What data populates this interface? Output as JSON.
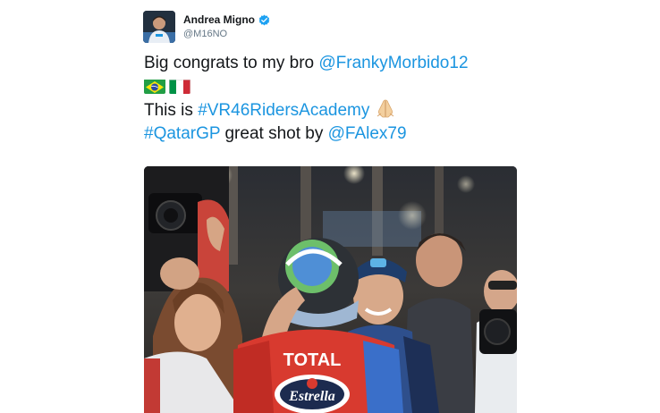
{
  "tweet": {
    "author": {
      "display_name": "Andrea Migno",
      "handle": "@M16NO",
      "verified_icon": "verified-badge-icon",
      "avatar_icon": "avatar"
    },
    "text": {
      "line1_prefix": "Big congrats to my bro ",
      "mention_1": "@FrankyMorbido12",
      "flags": [
        "flag-brazil-icon",
        "flag-italy-icon"
      ],
      "line3_prefix": "This is ",
      "hashtag_1": "#VR46RidersAcademy",
      "emoji": "folded-hands-icon",
      "hashtag_2": "#QatarGP",
      "line4_middle": " great shot by ",
      "mention_2": "@FAlex79"
    },
    "media": {
      "jacket_text": "TOTAL",
      "sponsor_text": "Estrella"
    }
  },
  "colors": {
    "link": "#1b95e0",
    "text": "#14171a",
    "muted": "#657786",
    "verified": "#1da1f2"
  }
}
